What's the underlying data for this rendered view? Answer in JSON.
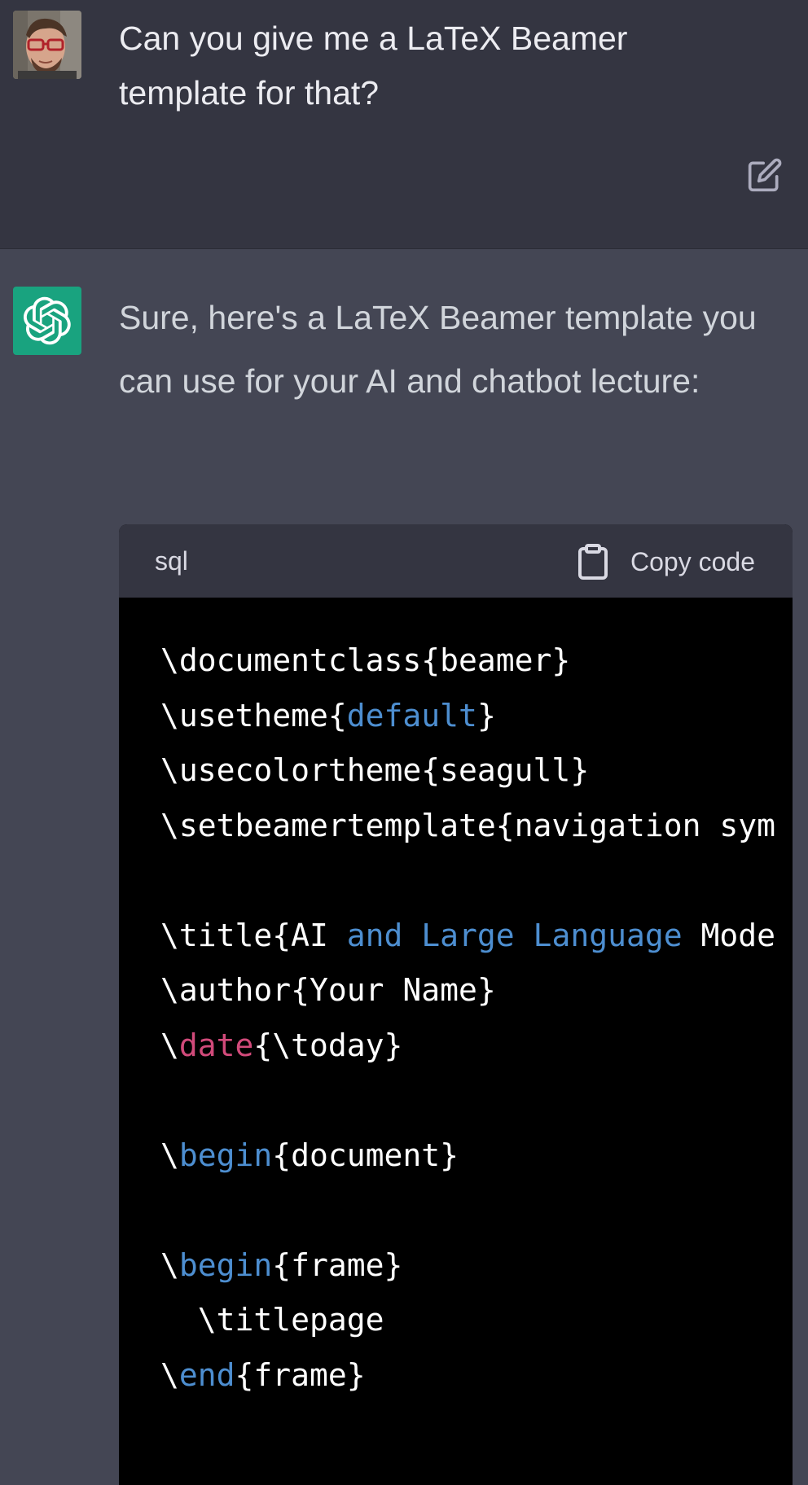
{
  "user": {
    "avatar_alt": "user-avatar",
    "message": "Can you give me a LaTeX Beamer template for that?"
  },
  "assistant": {
    "message": "Sure, here's a LaTeX Beamer template you can use for your AI and chatbot lecture:"
  },
  "code_block": {
    "language": "sql",
    "copy_label": "Copy code",
    "lines": [
      [
        {
          "t": "\\documentclass{beamer}",
          "c": "plain"
        }
      ],
      [
        {
          "t": "\\usetheme{",
          "c": "plain"
        },
        {
          "t": "default",
          "c": "kw"
        },
        {
          "t": "}",
          "c": "plain"
        }
      ],
      [
        {
          "t": "\\usecolortheme{seagull}",
          "c": "plain"
        }
      ],
      [
        {
          "t": "\\setbeamertemplate{navigation sym",
          "c": "plain"
        }
      ],
      [],
      [
        {
          "t": "\\title{AI ",
          "c": "plain"
        },
        {
          "t": "and Large Language",
          "c": "kw"
        },
        {
          "t": " Mode",
          "c": "plain"
        }
      ],
      [
        {
          "t": "\\author{Your Name}",
          "c": "plain"
        }
      ],
      [
        {
          "t": "\\",
          "c": "plain"
        },
        {
          "t": "date",
          "c": "red"
        },
        {
          "t": "{\\today}",
          "c": "plain"
        }
      ],
      [],
      [
        {
          "t": "\\",
          "c": "plain"
        },
        {
          "t": "begin",
          "c": "kw"
        },
        {
          "t": "{document}",
          "c": "plain"
        }
      ],
      [],
      [
        {
          "t": "\\",
          "c": "plain"
        },
        {
          "t": "begin",
          "c": "kw"
        },
        {
          "t": "{frame}",
          "c": "plain"
        }
      ],
      [
        {
          "t": "  \\titlepage",
          "c": "plain"
        }
      ],
      [
        {
          "t": "\\",
          "c": "plain"
        },
        {
          "t": "end",
          "c": "kw"
        },
        {
          "t": "{frame}",
          "c": "plain"
        }
      ],
      []
    ]
  },
  "colors": {
    "user_bg": "#343541",
    "assistant_bg": "#444654",
    "assistant_avatar_bg": "#19a37f",
    "code_bg": "#000000",
    "code_header_bg": "#343541",
    "keyword": "#4d8ed0",
    "keyword_red": "#d14a7a"
  },
  "icons": {
    "edit": "edit-icon",
    "copy": "clipboard-icon",
    "assistant_logo": "openai-logo-icon"
  }
}
